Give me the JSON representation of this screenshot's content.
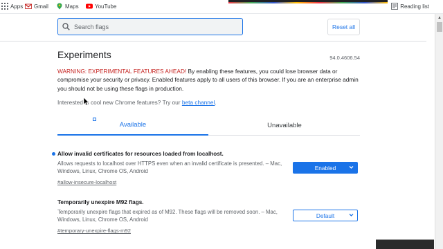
{
  "bookmarks": {
    "items": [
      {
        "label": "Apps",
        "icon": "apps-grid-icon"
      },
      {
        "label": "Gmail",
        "icon": "gmail-icon"
      },
      {
        "label": "Maps",
        "icon": "maps-icon"
      },
      {
        "label": "YouTube",
        "icon": "youtube-icon"
      }
    ],
    "reading_list": "Reading list"
  },
  "search": {
    "placeholder": "Search flags",
    "value": ""
  },
  "reset_label": "Reset all",
  "page": {
    "title": "Experiments",
    "version": "94.0.4606.54",
    "warning_prefix": "WARNING: EXPERIMENTAL FEATURES AHEAD!",
    "warning_body": " By enabling these features, you could lose browser data or compromise your security or privacy. Enabled features apply to all users of this browser. If you are an enterprise admin you should not be using these flags in production.",
    "interested_prefix": "Interested in cool new Chrome features? Try our ",
    "beta_link": "beta channel",
    "interested_suffix": "."
  },
  "tabs": [
    {
      "label": "Available",
      "active": true
    },
    {
      "label": "Unavailable",
      "active": false
    }
  ],
  "flags": [
    {
      "name": "Allow invalid certificates for resources loaded from localhost.",
      "description": "Allows requests to localhost over HTTPS even when an invalid certificate is presented. – Mac, Windows, Linux, Chrome OS, Android",
      "link": "#allow-insecure-localhost",
      "state": "Enabled",
      "modified": true
    },
    {
      "name": "Temporarily unexpire M92 flags.",
      "description": "Temporarily unexpire flags that expired as of M92. These flags will be removed soon. – Mac, Windows, Linux, Chrome OS, Android",
      "link": "#temporary-unexpire-flags-m92",
      "state": "Default",
      "modified": false
    }
  ],
  "colors": {
    "accent": "#1a73e8",
    "warning": "#c5221f"
  }
}
